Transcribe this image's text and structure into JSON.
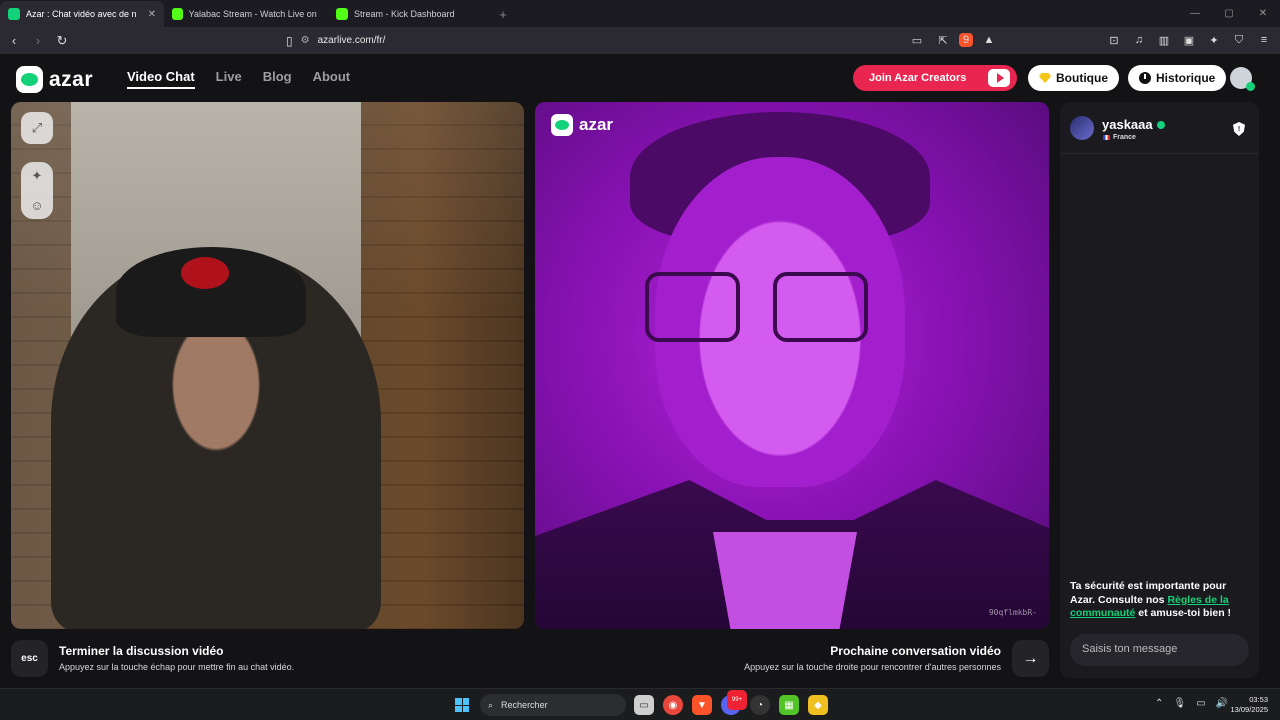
{
  "browser": {
    "tabs": [
      {
        "label": "Azar : Chat vidéo avec de no",
        "active": true,
        "color": "#13d27a"
      },
      {
        "label": "Yalabac Stream - Watch Live on Kick",
        "active": false,
        "color": "#53fc18"
      },
      {
        "label": "Stream - Kick Dashboard",
        "active": false,
        "color": "#53fc18"
      }
    ],
    "url": "azarlive.com/fr/",
    "brave_badge": "9",
    "alert_badge": "1"
  },
  "header": {
    "logo": "azar",
    "nav": [
      "Video Chat",
      "Live",
      "Blog",
      "About"
    ],
    "join_label": "Join Azar Creators",
    "boutique_label": "Boutique",
    "historique_label": "Historique",
    "accent": "#13d27a",
    "join_color": "#e8264f"
  },
  "remote_video": {
    "watermark": "azar",
    "id": "90qflmkbR-"
  },
  "controls": {
    "esc_label": "esc",
    "end_title": "Terminer la discussion vidéo",
    "end_sub": "Appuyez sur la touche échap pour mettre fin au chat vidéo.",
    "next_title": "Prochaine conversation vidéo",
    "next_sub": "Appuyez sur la touche droite pour rencontrer d'autres personnes"
  },
  "chat": {
    "username": "yaskaaa",
    "country": "France",
    "safety_pre": "Ta sécurité est importante pour Azar. Consulte nos ",
    "safety_link": "Règles de la communauté",
    "safety_post": " et amuse-toi bien !",
    "placeholder": "Saisis ton message"
  },
  "taskbar": {
    "search": "Rechercher",
    "time": "03:53",
    "date": "13/09/2025",
    "discord_badge": "99+"
  }
}
